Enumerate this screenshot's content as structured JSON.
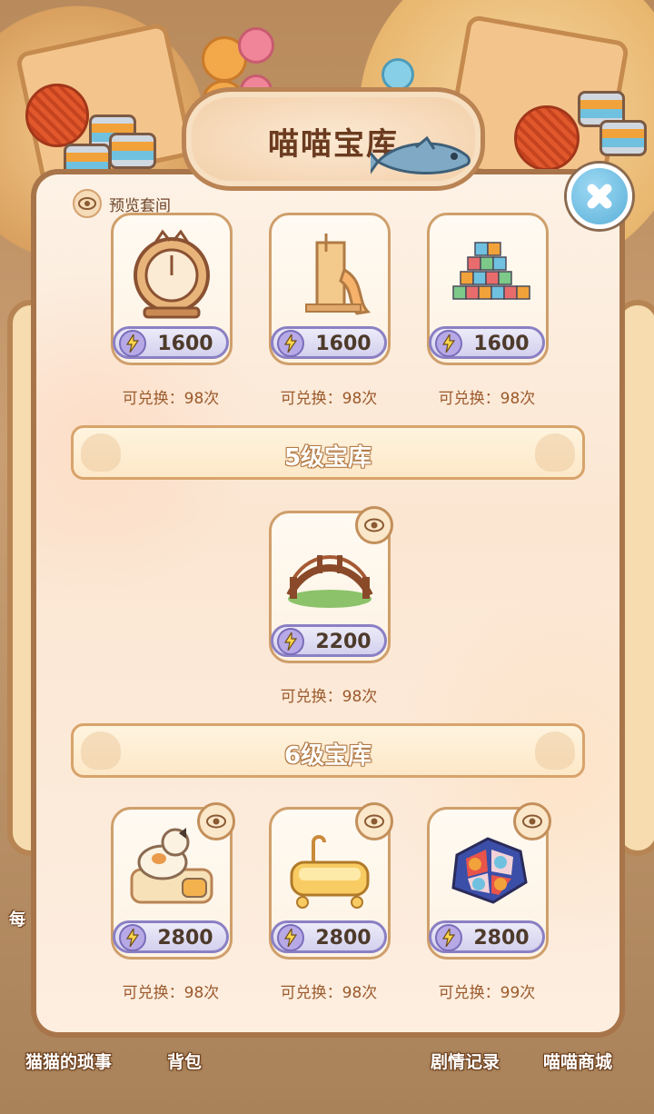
{
  "title": "喵喵宝库",
  "preview_label": "预览套间",
  "levels": [
    {
      "label": "5级宝库"
    },
    {
      "label": "6级宝库"
    }
  ],
  "items_top": [
    {
      "icon": "cat-ring-clock-icon",
      "price": "1600",
      "redeem": "可兑换：98次"
    },
    {
      "icon": "cat-tower-slide-icon",
      "price": "1600",
      "redeem": "可兑换：98次"
    },
    {
      "icon": "can-pyramid-icon",
      "price": "1600",
      "redeem": "可兑换：98次"
    }
  ],
  "items_level5": [
    {
      "icon": "wooden-bridge-icon",
      "price": "2200",
      "redeem": "可兑换：98次"
    }
  ],
  "items_level6": [
    {
      "icon": "calico-cat-bed-icon",
      "price": "2800",
      "redeem": "可兑换：98次"
    },
    {
      "icon": "cat-bathtub-icon",
      "price": "2800",
      "redeem": "可兑换：98次"
    },
    {
      "icon": "play-mat-icon",
      "price": "2800",
      "redeem": "可兑换：99次"
    }
  ],
  "bottom_nav": [
    "猫猫的琐事",
    "背包",
    "剧情记录",
    "喵喵商城"
  ],
  "side_text": "每",
  "colors": {
    "price_border": "#8b80c4",
    "banner_border": "#d8a36b",
    "title_text": "#6b3b1f"
  }
}
